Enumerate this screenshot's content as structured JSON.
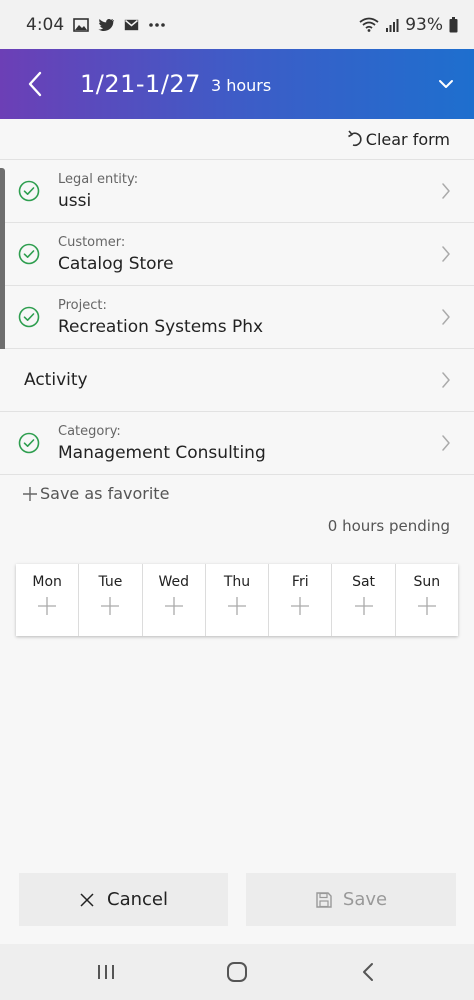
{
  "status_bar": {
    "time": "4:04",
    "battery": "93%"
  },
  "header": {
    "title": "1/21-1/27",
    "subtitle": "3 hours"
  },
  "clear_form_label": "Clear form",
  "fields": {
    "legal_entity": {
      "label": "Legal entity:",
      "value": "ussi"
    },
    "customer": {
      "label": "Customer:",
      "value": "Catalog Store"
    },
    "project": {
      "label": "Project:",
      "value": "Recreation Systems Phx"
    },
    "activity": {
      "value": "Activity"
    },
    "category": {
      "label": "Category:",
      "value": "Management Consulting"
    }
  },
  "save_favorite_label": "Save as favorite",
  "pending_label": "0 hours pending",
  "days": [
    "Mon",
    "Tue",
    "Wed",
    "Thu",
    "Fri",
    "Sat",
    "Sun"
  ],
  "buttons": {
    "cancel": "Cancel",
    "save": "Save"
  },
  "colors": {
    "check_green": "#2e9e4f",
    "header_start": "#6c3fb6",
    "header_end": "#1e6fce"
  }
}
